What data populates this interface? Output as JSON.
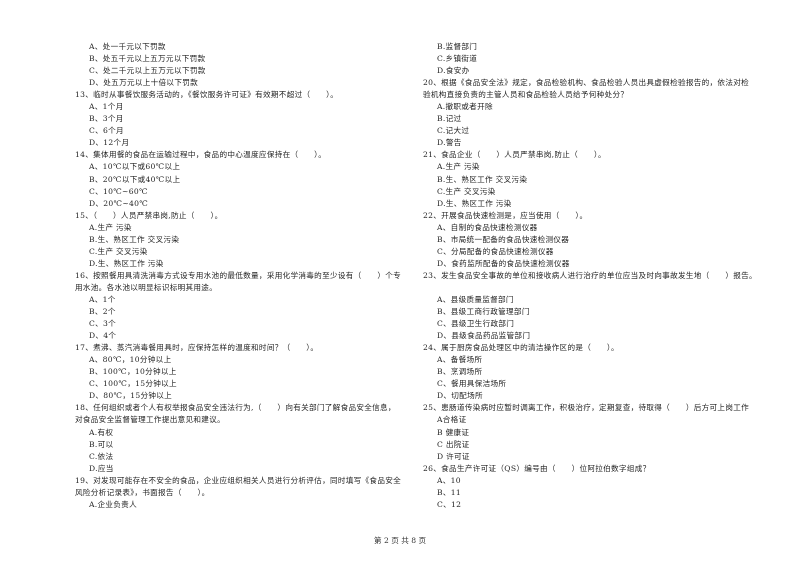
{
  "columns": {
    "left": [
      {
        "t": "opt",
        "text": "A、处一千元以下罚款"
      },
      {
        "t": "opt",
        "text": "B、处五千元以上五万元以下罚款"
      },
      {
        "t": "opt",
        "text": "C、处二千元以上五万元以下罚款"
      },
      {
        "t": "opt",
        "text": "D、处五万元以上十倍以下罚款"
      },
      {
        "t": "q",
        "text": "13、临时从事餐饮服务活动的，《餐饮服务许可证》有效期不超过（　　）。"
      },
      {
        "t": "opt",
        "text": "A、1个月"
      },
      {
        "t": "opt",
        "text": "B、3个月"
      },
      {
        "t": "opt",
        "text": "C、6个月"
      },
      {
        "t": "opt",
        "text": "D、12个月"
      },
      {
        "t": "q",
        "text": "14、集体用餐的食品在运输过程中，食品的中心温度应保持在（　　）。"
      },
      {
        "t": "opt",
        "text": "A、10℃以下或60℃以上"
      },
      {
        "t": "opt",
        "text": "B、20℃以下或40℃以上"
      },
      {
        "t": "opt",
        "text": "C、10℃~60℃"
      },
      {
        "t": "opt",
        "text": "D、20℃~40℃"
      },
      {
        "t": "q",
        "text": "15、（　　）人员严禁串岗,防止（　　）。"
      },
      {
        "t": "opt",
        "text": "A.生产 污染"
      },
      {
        "t": "opt",
        "text": "B.生、熟区工作 交叉污染"
      },
      {
        "t": "opt",
        "text": "C.生产 交叉污染"
      },
      {
        "t": "opt",
        "text": "D.生、熟区工作 污染"
      },
      {
        "t": "q",
        "text": "16、按照餐用具清洗消毒方式设专用水池的最低数量，采用化学消毒的至少设有（　　）个专"
      },
      {
        "t": "q",
        "text": "用水池。各水池以明显标识标明其用途。"
      },
      {
        "t": "opt",
        "text": "A、1个"
      },
      {
        "t": "opt",
        "text": "B、2个"
      },
      {
        "t": "opt",
        "text": "C、3个"
      },
      {
        "t": "opt",
        "text": "D、4个"
      },
      {
        "t": "q",
        "text": "17、煮沸、蒸汽消毒餐用具时，应保持怎样的温度和时间？（　　）。"
      },
      {
        "t": "opt",
        "text": "A、80℃，10分钟以上"
      },
      {
        "t": "opt",
        "text": "B、100℃，10分钟以上"
      },
      {
        "t": "opt",
        "text": "C、100℃，15分钟以上"
      },
      {
        "t": "opt",
        "text": "D、80℃，15分钟以上"
      },
      {
        "t": "q",
        "text": "18、任何组织或者个人有权举报食品安全违法行为,（　　）向有关部门了解食品安全信息，"
      },
      {
        "t": "q",
        "text": "对食品安全监督管理工作提出意见和建议。"
      },
      {
        "t": "opt",
        "text": "A.有权"
      },
      {
        "t": "opt",
        "text": "B.可以"
      },
      {
        "t": "opt",
        "text": "C.依法"
      },
      {
        "t": "opt",
        "text": "D.应当"
      },
      {
        "t": "q",
        "text": "19、对发现可能存在不安全的食品，企业应组织相关人员进行分析评估，同时填写《食品安全"
      },
      {
        "t": "q",
        "text": "风险分析记录表》，书面报告（　　）。"
      },
      {
        "t": "opt",
        "text": "A.企业负责人"
      }
    ],
    "right": [
      {
        "t": "opt",
        "text": "B.监督部门"
      },
      {
        "t": "opt",
        "text": "C.乡镇街道"
      },
      {
        "t": "opt",
        "text": "D.食安办"
      },
      {
        "t": "q",
        "text": "20、根据《食品安全法》规定，食品检验机构、食品检验人员出具虚假检验报告的，依法对检"
      },
      {
        "t": "q",
        "text": "验机构直接负责的主管人员和食品检验人员给予何种处分？"
      },
      {
        "t": "opt",
        "text": "A.撤职或者开除"
      },
      {
        "t": "opt",
        "text": "B.记过"
      },
      {
        "t": "opt",
        "text": "C.记大过"
      },
      {
        "t": "opt",
        "text": "D.警告"
      },
      {
        "t": "q",
        "text": "21、食品企业（　　）人员严禁串岗,防止（　　）。"
      },
      {
        "t": "opt",
        "text": "A.生产 污染"
      },
      {
        "t": "opt",
        "text": "B.生、熟区工作 交叉污染"
      },
      {
        "t": "opt",
        "text": "C.生产 交叉污染"
      },
      {
        "t": "opt",
        "text": "D.生、熟区工作 污染"
      },
      {
        "t": "q",
        "text": "22、开展食品快速检测是，应当使用（　　）。"
      },
      {
        "t": "opt",
        "text": "A、自制的食品快速检测仪器"
      },
      {
        "t": "opt",
        "text": "B、市局统一配备的食品快速检测仪器"
      },
      {
        "t": "opt",
        "text": "C、分局配备的食品快速检测仪器"
      },
      {
        "t": "opt",
        "text": "D、食药监所配备的食品快速检测仪器"
      },
      {
        "t": "q",
        "text": "23、发生食品安全事故的单位和接收病人进行治疗的单位应当及时向事故发生地（　　）报告。"
      },
      {
        "t": "q",
        "text": ""
      },
      {
        "t": "opt",
        "text": "A、县级质量监督部门"
      },
      {
        "t": "opt",
        "text": "B、县级工商行政管理部门"
      },
      {
        "t": "opt",
        "text": "C、县级卫生行政部门"
      },
      {
        "t": "opt",
        "text": "D、县级食品药品监管部门"
      },
      {
        "t": "q",
        "text": "24、属于厨房食品处理区中的清洁操作区的是（　　）。"
      },
      {
        "t": "opt",
        "text": "A、备餐场所"
      },
      {
        "t": "opt",
        "text": "B、烹调场所"
      },
      {
        "t": "opt",
        "text": "C、餐用具保洁场所"
      },
      {
        "t": "opt",
        "text": "D、切配场所"
      },
      {
        "t": "q",
        "text": "25、患肠道传染病时应暂时调离工作，积极治疗，定期复查，待取得（　　）后方可上岗工作"
      },
      {
        "t": "opt",
        "text": "A合格证"
      },
      {
        "t": "opt",
        "text": "B 健康证"
      },
      {
        "t": "opt",
        "text": "C 出院证"
      },
      {
        "t": "opt",
        "text": "D 许可证"
      },
      {
        "t": "q",
        "text": "26、食品生产许可证（QS）编号由（　　）位阿拉伯数字组成？"
      },
      {
        "t": "opt",
        "text": "A、10"
      },
      {
        "t": "opt",
        "text": "B、11"
      },
      {
        "t": "opt",
        "text": "C、12"
      }
    ]
  },
  "footer": "第 2 页 共 8 页"
}
